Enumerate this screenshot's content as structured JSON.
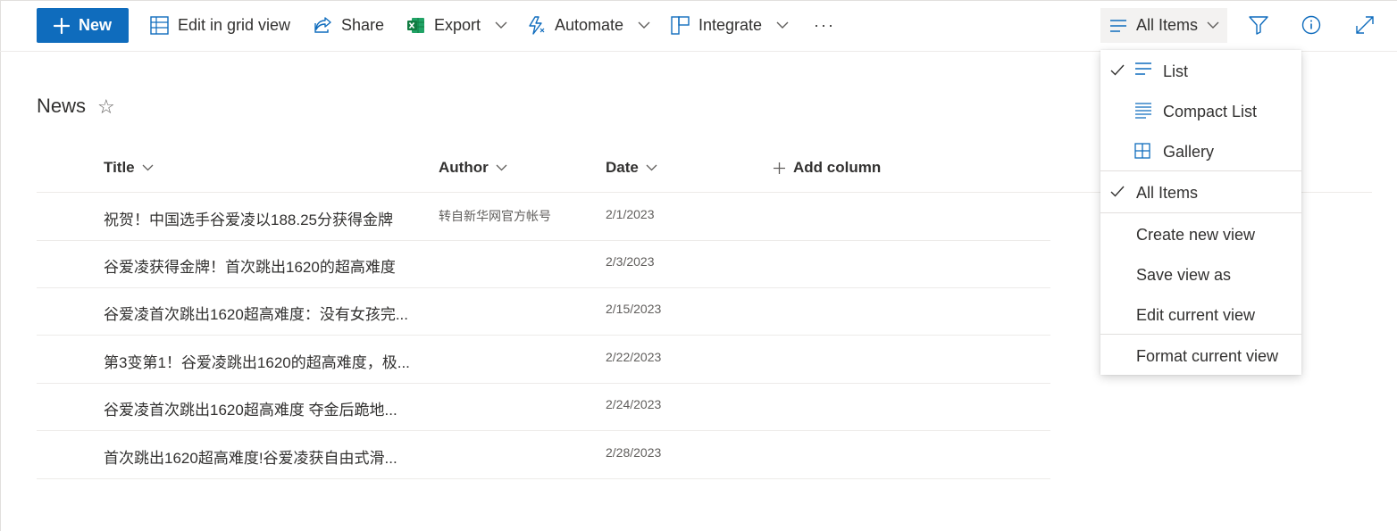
{
  "toolbar": {
    "new_label": "New",
    "grid_label": "Edit in grid view",
    "share_label": "Share",
    "export_label": "Export",
    "automate_label": "Automate",
    "integrate_label": "Integrate",
    "more_label": "···",
    "view_label": "All Items"
  },
  "list": {
    "title": "News",
    "columns": {
      "title": "Title",
      "author": "Author",
      "date": "Date",
      "add": "Add column"
    },
    "rows": [
      {
        "title": "祝贺！中国选手谷爱凌以188.25分获得金牌",
        "author": "转自新华网官方帐号",
        "date": "2/1/2023"
      },
      {
        "title": "谷爱凌获得金牌！首次跳出1620的超高难度",
        "author": "",
        "date": "2/3/2023"
      },
      {
        "title": "谷爱凌首次跳出1620超高难度：没有女孩完...",
        "author": "",
        "date": "2/15/2023"
      },
      {
        "title": "第3变第1！谷爱凌跳出1620的超高难度，极...",
        "author": "",
        "date": "2/22/2023"
      },
      {
        "title": "谷爱凌首次跳出1620超高难度 夺金后跪地...",
        "author": "",
        "date": "2/24/2023"
      },
      {
        "title": "首次跳出1620超高难度!谷爱凌获自由式滑...",
        "author": "",
        "date": "2/28/2023"
      }
    ]
  },
  "menu": {
    "list": "List",
    "compact_list": "Compact List",
    "gallery": "Gallery",
    "all_items": "All Items",
    "create_new_view": "Create new view",
    "save_view_as": "Save view as",
    "edit_current_view": "Edit current view",
    "format_current_view": "Format current view"
  },
  "colors": {
    "accent": "#0f6cbd",
    "excel": "#107c41",
    "text": "#323130",
    "subtle": "#605e5c"
  }
}
